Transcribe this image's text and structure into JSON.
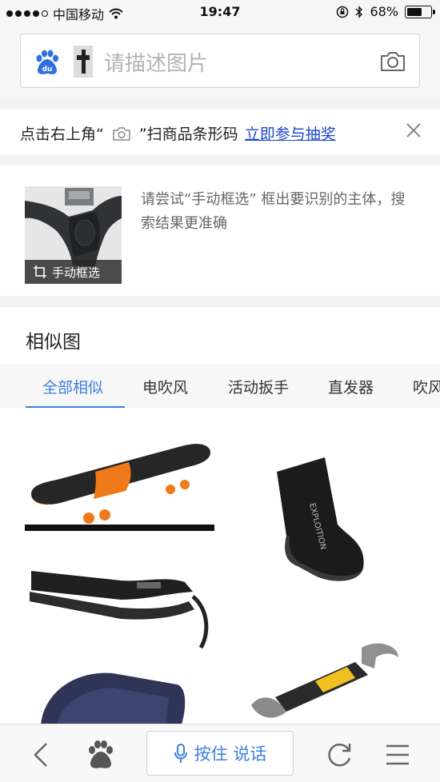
{
  "status": {
    "carrier": "中国移动",
    "time": "19:47",
    "battery_percent": "68%",
    "battery_level": 0.68,
    "signal_bars": 4
  },
  "search": {
    "placeholder": "请描述图片",
    "logo_icon": "baidu-paw-logo-icon",
    "camera_icon": "camera-icon"
  },
  "notice": {
    "prefix": "点击右上角“",
    "suffix": "”扫商品条形码",
    "link": "立即参与抽奖",
    "close_icon": "close-icon"
  },
  "hint": {
    "crop_label": "手动框选",
    "text": "请尝试“手动框选” 框出要识别的主体，搜索结果更准确"
  },
  "similar": {
    "title": "相似图",
    "tabs": [
      {
        "label": "全部相似",
        "active": true
      },
      {
        "label": "电吹风",
        "active": false
      },
      {
        "label": "活动扳手",
        "active": false
      },
      {
        "label": "直发器",
        "active": false
      },
      {
        "label": "吹风",
        "active": false
      }
    ]
  },
  "toolbar": {
    "voice_label": "按住 说话",
    "back_icon": "back-arrow-icon",
    "home_icon": "baidu-paw-icon",
    "mic_icon": "microphone-icon",
    "refresh_icon": "refresh-icon",
    "menu_icon": "menu-icon"
  },
  "colors": {
    "accent": "#3b7fe0",
    "link": "#1a46c8",
    "skateboard_orange": "#f07a1a",
    "wrench_yellow": "#f0c020"
  }
}
